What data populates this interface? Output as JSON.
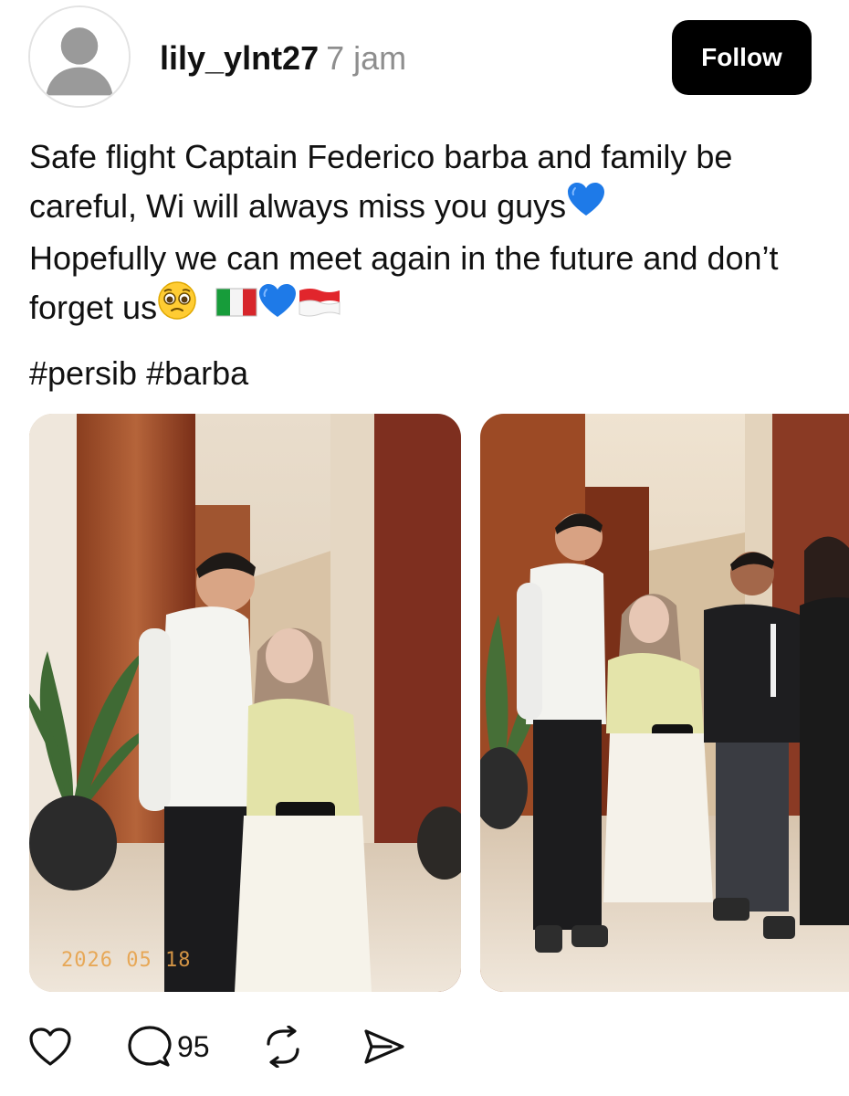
{
  "header": {
    "username": "lily_ylnt27",
    "timestamp": "7 jam",
    "follow_label": "Follow"
  },
  "caption": {
    "line1": "Safe flight Captain Federico barba and family be careful, Wi will always miss you guys",
    "line2_a": "Hopefully we can meet again in the future and don’t forget us",
    "emojis_line1": "blue-heart",
    "emojis_line2": [
      "pleading-face",
      "flag-italy",
      "blue-heart",
      "flag-indonesia"
    ]
  },
  "hashtags": [
    "#persib",
    "#barba"
  ],
  "media": [
    {
      "description_icon": "photo",
      "date_stamp": "2026 05 18"
    },
    {
      "description_icon": "photo"
    }
  ],
  "actions": {
    "like_icon": "heart-icon",
    "comment_icon": "comment-icon",
    "comment_count": "95",
    "repost_icon": "repost-icon",
    "share_icon": "share-icon"
  },
  "colors": {
    "follow_bg": "#000000",
    "follow_text": "#ffffff",
    "muted": "#8e8e8e",
    "blue_heart": "#1e7ae8"
  }
}
